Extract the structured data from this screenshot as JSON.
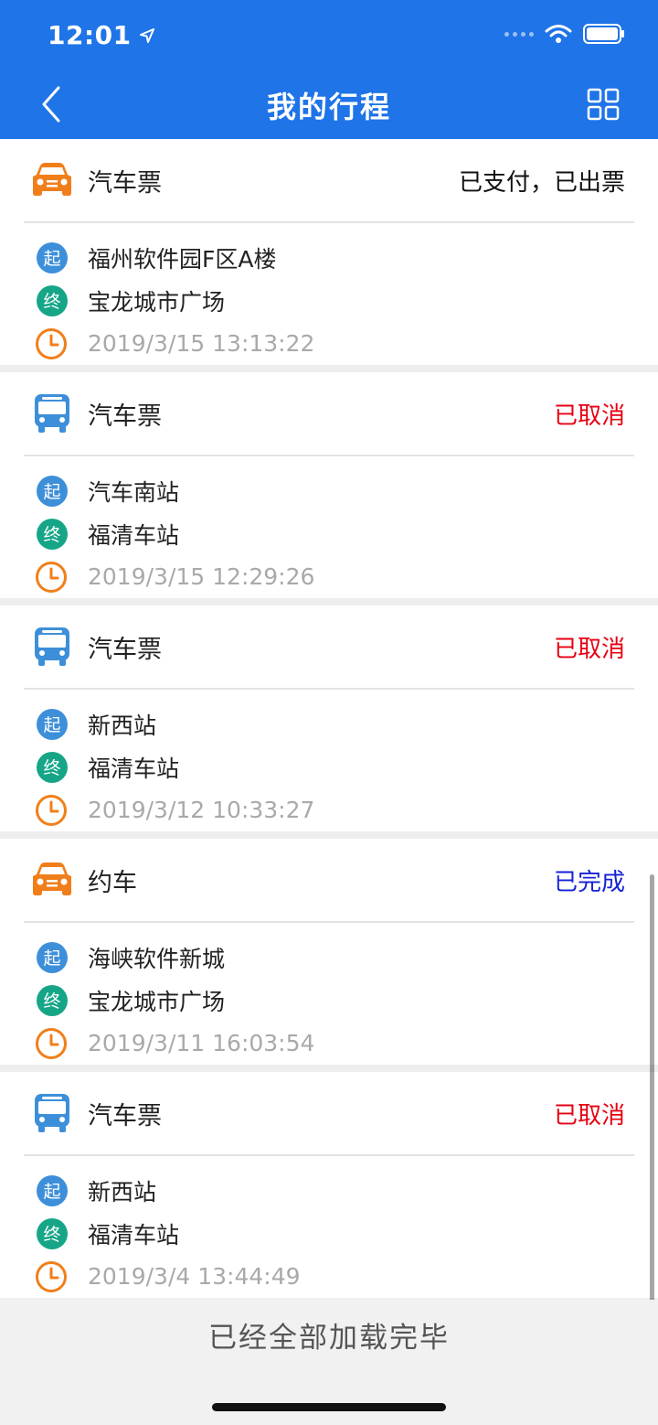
{
  "status_bar": {
    "time": "12:01"
  },
  "nav": {
    "title": "我的行程"
  },
  "trips": [
    {
      "kind": "car",
      "type_label": "汽车票",
      "status": "已支付，已出票",
      "status_color": "#111111",
      "start_badge": "起",
      "start": "福州软件园F区A楼",
      "end_badge": "终",
      "end": "宝龙城市广场",
      "datetime": "2019/3/15 13:13:22"
    },
    {
      "kind": "bus",
      "type_label": "汽车票",
      "status": "已取消",
      "status_color": "#e60012",
      "start_badge": "起",
      "start": "汽车南站",
      "end_badge": "终",
      "end": "福清车站",
      "datetime": "2019/3/15 12:29:26"
    },
    {
      "kind": "bus",
      "type_label": "汽车票",
      "status": "已取消",
      "status_color": "#e60012",
      "start_badge": "起",
      "start": "新西站",
      "end_badge": "终",
      "end": "福清车站",
      "datetime": "2019/3/12 10:33:27"
    },
    {
      "kind": "car",
      "type_label": "约车",
      "status": "已完成",
      "status_color": "#1522d6",
      "start_badge": "起",
      "start": "海峡软件新城",
      "end_badge": "终",
      "end": "宝龙城市广场",
      "datetime": "2019/3/11 16:03:54"
    },
    {
      "kind": "bus",
      "type_label": "汽车票",
      "status": "已取消",
      "status_color": "#e60012",
      "start_badge": "起",
      "start": "新西站",
      "end_badge": "终",
      "end": "福清车站",
      "datetime": "2019/3/4 13:44:49"
    }
  ],
  "footer": {
    "text": "已经全部加载完毕"
  },
  "colors": {
    "header": "#1f74e7",
    "car_icon": "#f07f1b",
    "bus_icon": "#3d8fd9",
    "start_badge": "#3d8fd9",
    "end_badge": "#16a687",
    "clock": "#f07f1b"
  },
  "icons": {
    "car": "car-icon",
    "bus": "bus-icon",
    "clock": "clock-icon",
    "back": "chevron-left-icon",
    "scan": "grid-scan-icon"
  }
}
